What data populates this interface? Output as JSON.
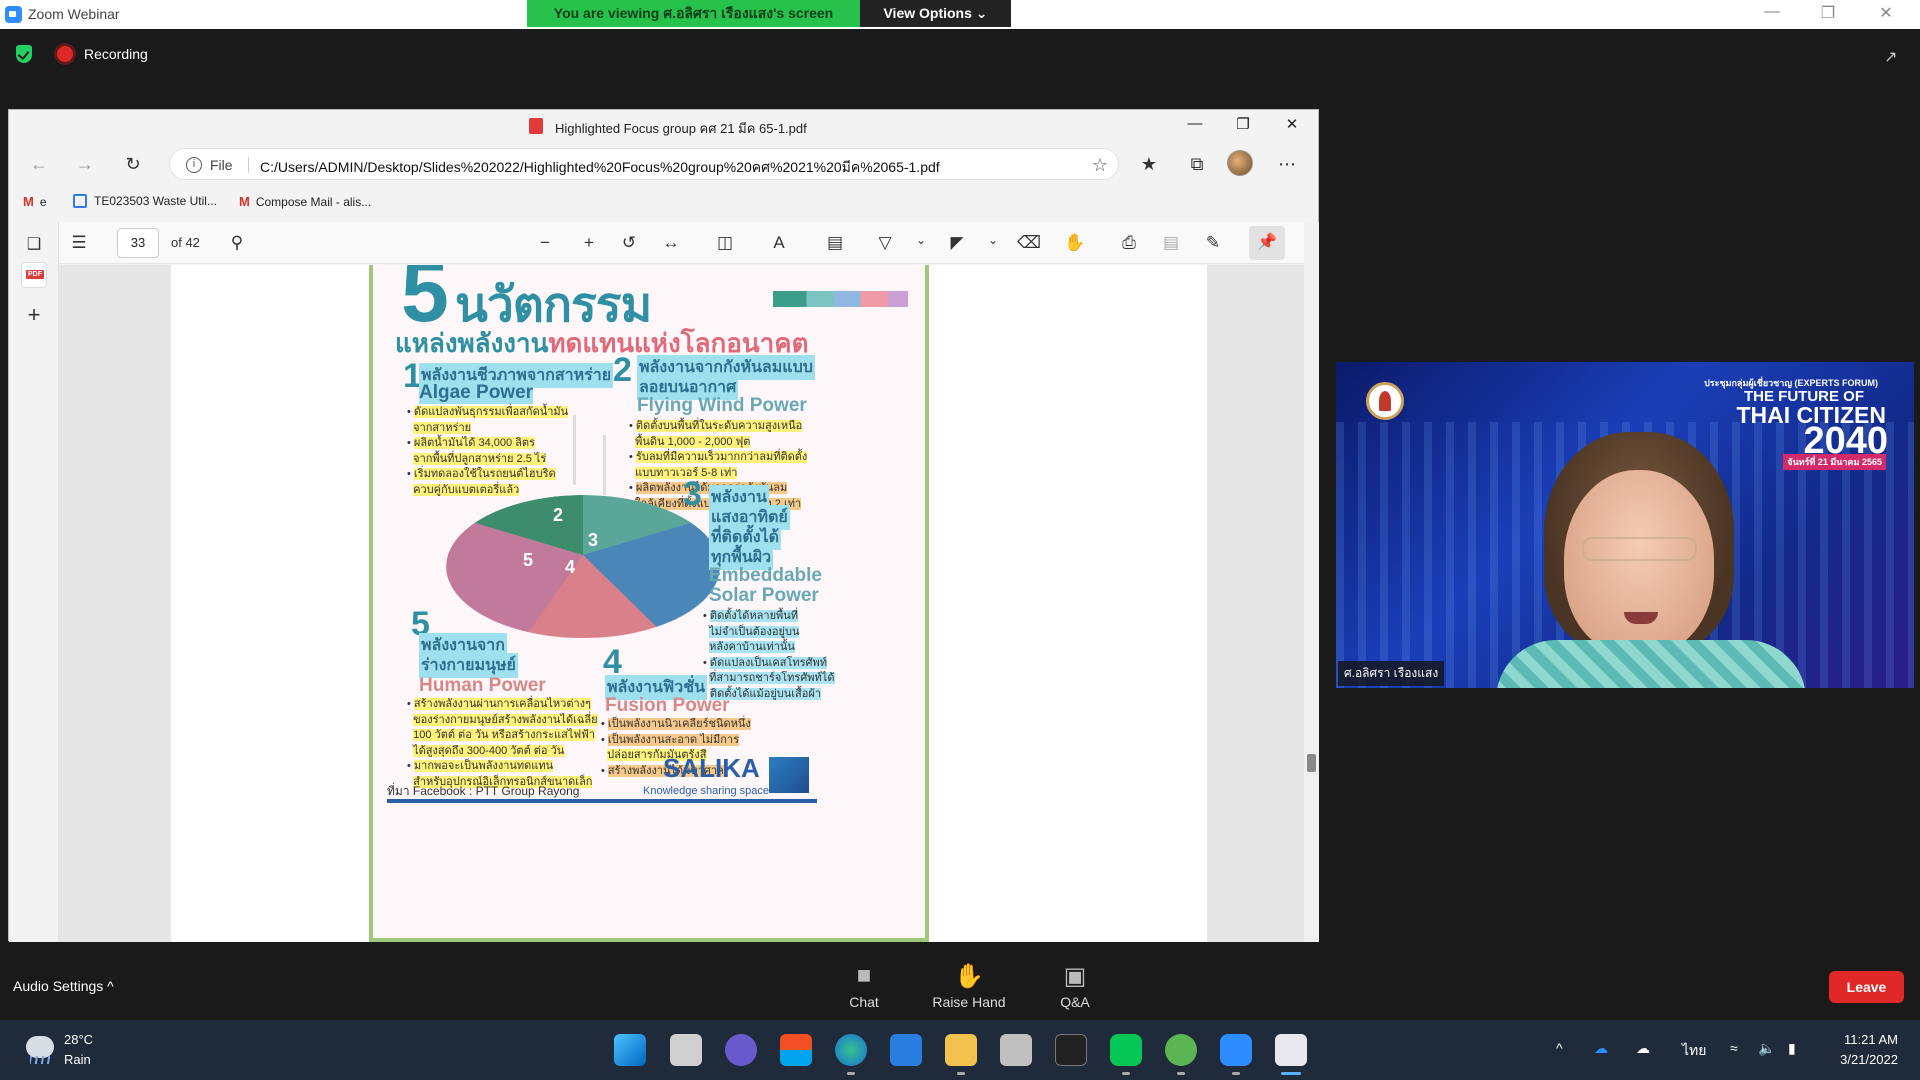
{
  "zoom": {
    "app_title": "Zoom Webinar",
    "viewing_banner": "You are viewing ศ.อลิศรา เรืองแสง's screen",
    "view_options": "View Options ⌄",
    "recording": "Recording",
    "audio_settings": "Audio Settings ^",
    "controls": [
      {
        "label": "Chat",
        "icon": "chat-icon"
      },
      {
        "label": "Raise Hand",
        "icon": "raise-hand-icon"
      },
      {
        "label": "Q&A",
        "icon": "qa-icon"
      }
    ],
    "leave": "Leave",
    "participant_name": "ศ.อลิศรา เรืองแสง"
  },
  "edge": {
    "title": "Highlighted Focus group คศ 21 มีค 65-1.pdf",
    "file_label": "File",
    "url": "C:/Users/ADMIN/Desktop/Slides%202022/Highlighted%20Focus%20group%20คศ%2021%20มีค%2065-1.pdf",
    "bookmarks": [
      {
        "label": "e",
        "icon": "gmail-icon"
      },
      {
        "label": "TE023503 Waste Util...",
        "icon": "doc-icon"
      },
      {
        "label": "Compose Mail - alis...",
        "icon": "gmail-icon"
      }
    ],
    "pdf": {
      "page_number": "33",
      "page_total": "of 42"
    }
  },
  "infographic": {
    "big_number": "5",
    "headline": "นวัตกรรม",
    "subheadline_a": "แหล่งพลังงาน",
    "subheadline_b": "ทดแทนแห่งโลกอนาคต",
    "s1": {
      "num": "1",
      "th": "พลังงานชีวภาพจากสาหร่าย",
      "en": "Algae Power",
      "b1": "ดัดแปลงพันธุกรรมเพื่อสกัดน้ำมัน",
      "b1b": "จากสาหร่าย",
      "b2": "ผลิตน้ำมันได้ 34,000 ลิตร",
      "b2b": "จากพื้นที่ปลูกสาหร่าย 2.5 ไร่",
      "b3": "เริ่มทดลองใช้ในรถยนต์ไฮบริด",
      "b3b": "ควบคู่กับแบตเตอรี่แล้ว"
    },
    "s2": {
      "num": "2",
      "th": "พลังงานจากกังหันลมแบบ",
      "th2": "ลอยบนอากาศ",
      "en": "Flying Wind Power",
      "b1": "ติดตั้งบนพื้นที่ในระดับความสูงเหนือ",
      "b1b": "พื้นดิน 1,000 - 2,000 ฟุต",
      "b2": "รับลมที่มีความเร็วมากกว่าลมที่ติดตั้ง",
      "b2b": "แบบทาวเวอร์ 5-8 เท่า",
      "b3": "ผลิตพลังงานได้มากกว่ากังหันลม",
      "b3b": "ใกล้เคียงที่ตั้งแบบทาวเวอร์ถึง 2 เท่า"
    },
    "s3": {
      "num": "3",
      "th1": "พลังงาน",
      "th2": "แสงอาทิตย์",
      "th3": "ที่ติดตั้งได้",
      "th4": "ทุกพื้นผิว",
      "en1": "Embeddable",
      "en2": "Solar Power",
      "b1": "ติดตั้งได้หลายพื้นที่",
      "b1b": "ไม่จำเป็นต้องอยู่บน",
      "b1c": "หลังคาบ้านเท่านั้น",
      "b2": "ดัดแปลงเป็นเคสโทรศัพท์",
      "b2b": "ที่สามารถชาร์จโทรศัพท์ได้",
      "b3": "ติดตั้งได้แม้อยู่บนเสื้อผ้า"
    },
    "s4": {
      "num": "4",
      "th": "พลังงานฟิวชั่น",
      "en": "Fusion Power",
      "b1": "เป็นพลังงานนิวเคลียร์ชนิดหนึ่ง",
      "b2": "เป็นพลังงานสะอาด ไม่มีการ",
      "b2b": "ปล่อยสารกัมมันตรังสี",
      "b3": "สร้างพลังงานได้มหาศาล"
    },
    "s5": {
      "num": "5",
      "th1": "พลังงานจาก",
      "th2": "ร่างกายมนุษย์",
      "en": "Human Power",
      "b1": "สร้างพลังงานผ่านการเคลื่อนไหวต่างๆ",
      "b1b": "ของร่างกายมนุษย์สร้างพลังงานได้เฉลี่ย",
      "b1c": "100 วัตต์ ต่อ วัน หรือสร้างกระแสไฟฟ้า",
      "b1d": "ได้สูงสุดถึง 300-400 วัตต์ ต่อ วัน",
      "b2": "มากพอจะเป็นพลังงานทดแทน",
      "b2b": "สำหรับอุปกรณ์อิเล็กทรอนิกส์ขนาดเล็ก"
    },
    "pie_labels": [
      "2",
      "3",
      "4",
      "5"
    ],
    "brand": "SALIKA",
    "brand_sub": "Knowledge sharing space",
    "source": "ที่มา Facebook : PTT Group Rayong"
  },
  "video": {
    "forum": "ประชุมกลุ่มผู้เชี่ยวชาญ (EXPERTS FORUM)",
    "future": "THE FUTURE OF",
    "thai": "THAI CITIZEN",
    "year": "2040",
    "date": "จันทร์ที่ 21 มีนาคม 2565"
  },
  "taskbar": {
    "temp": "28°C",
    "condition": "Rain",
    "lang": "ไทย",
    "time": "11:21 AM",
    "date": "3/21/2022"
  },
  "colors": {
    "recording": "#e02828",
    "leave": "#e02828",
    "banner": "#27c24c",
    "accent": "#2f8fa3"
  }
}
